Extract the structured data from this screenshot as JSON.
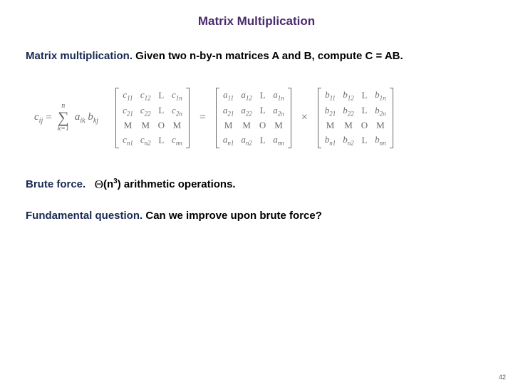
{
  "title": "Matrix Multiplication",
  "intro": {
    "lead": "Matrix multiplication.",
    "rest": "  Given two n-by-n matrices A and B, compute C = AB."
  },
  "formula": {
    "lhs_base": "c",
    "lhs_sub": "ij",
    "eq": " = ",
    "upper": "n",
    "sigma": "∑",
    "lower": "k=1",
    "term1_base": "a",
    "term1_sub": "ik",
    "term2_base": "b",
    "term2_sub": "kj"
  },
  "matrices": {
    "C": [
      [
        "c",
        "11",
        "c",
        "12",
        "L",
        "",
        "c",
        "1n"
      ],
      [
        "c",
        "21",
        "c",
        "22",
        "L",
        "",
        "c",
        "2n"
      ],
      [
        "M",
        "",
        "M",
        "",
        "O",
        "",
        "M",
        ""
      ],
      [
        "c",
        "n1",
        "c",
        "n2",
        "L",
        "",
        "c",
        "nn"
      ]
    ],
    "eq": "=",
    "A": [
      [
        "a",
        "11",
        "a",
        "12",
        "L",
        "",
        "a",
        "1n"
      ],
      [
        "a",
        "21",
        "a",
        "22",
        "L",
        "",
        "a",
        "2n"
      ],
      [
        "M",
        "",
        "M",
        "",
        "O",
        "",
        "M",
        ""
      ],
      [
        "a",
        "n1",
        "a",
        "n2",
        "L",
        "",
        "a",
        "nn"
      ]
    ],
    "times": "×",
    "B": [
      [
        "b",
        "11",
        "b",
        "12",
        "L",
        "",
        "b",
        "1n"
      ],
      [
        "b",
        "21",
        "b",
        "22",
        "L",
        "",
        "b",
        "2n"
      ],
      [
        "M",
        "",
        "M",
        "",
        "O",
        "",
        "M",
        ""
      ],
      [
        "b",
        "n1",
        "b",
        "n2",
        "L",
        "",
        "b",
        "nn"
      ]
    ]
  },
  "brute": {
    "lead": "Brute force.",
    "theta": "Θ",
    "open": "(n",
    "exp": "3",
    "close": ")",
    "rest": " arithmetic operations."
  },
  "fundamental": {
    "lead": "Fundamental question.",
    "rest": "  Can we improve upon brute force?"
  },
  "page": "42"
}
